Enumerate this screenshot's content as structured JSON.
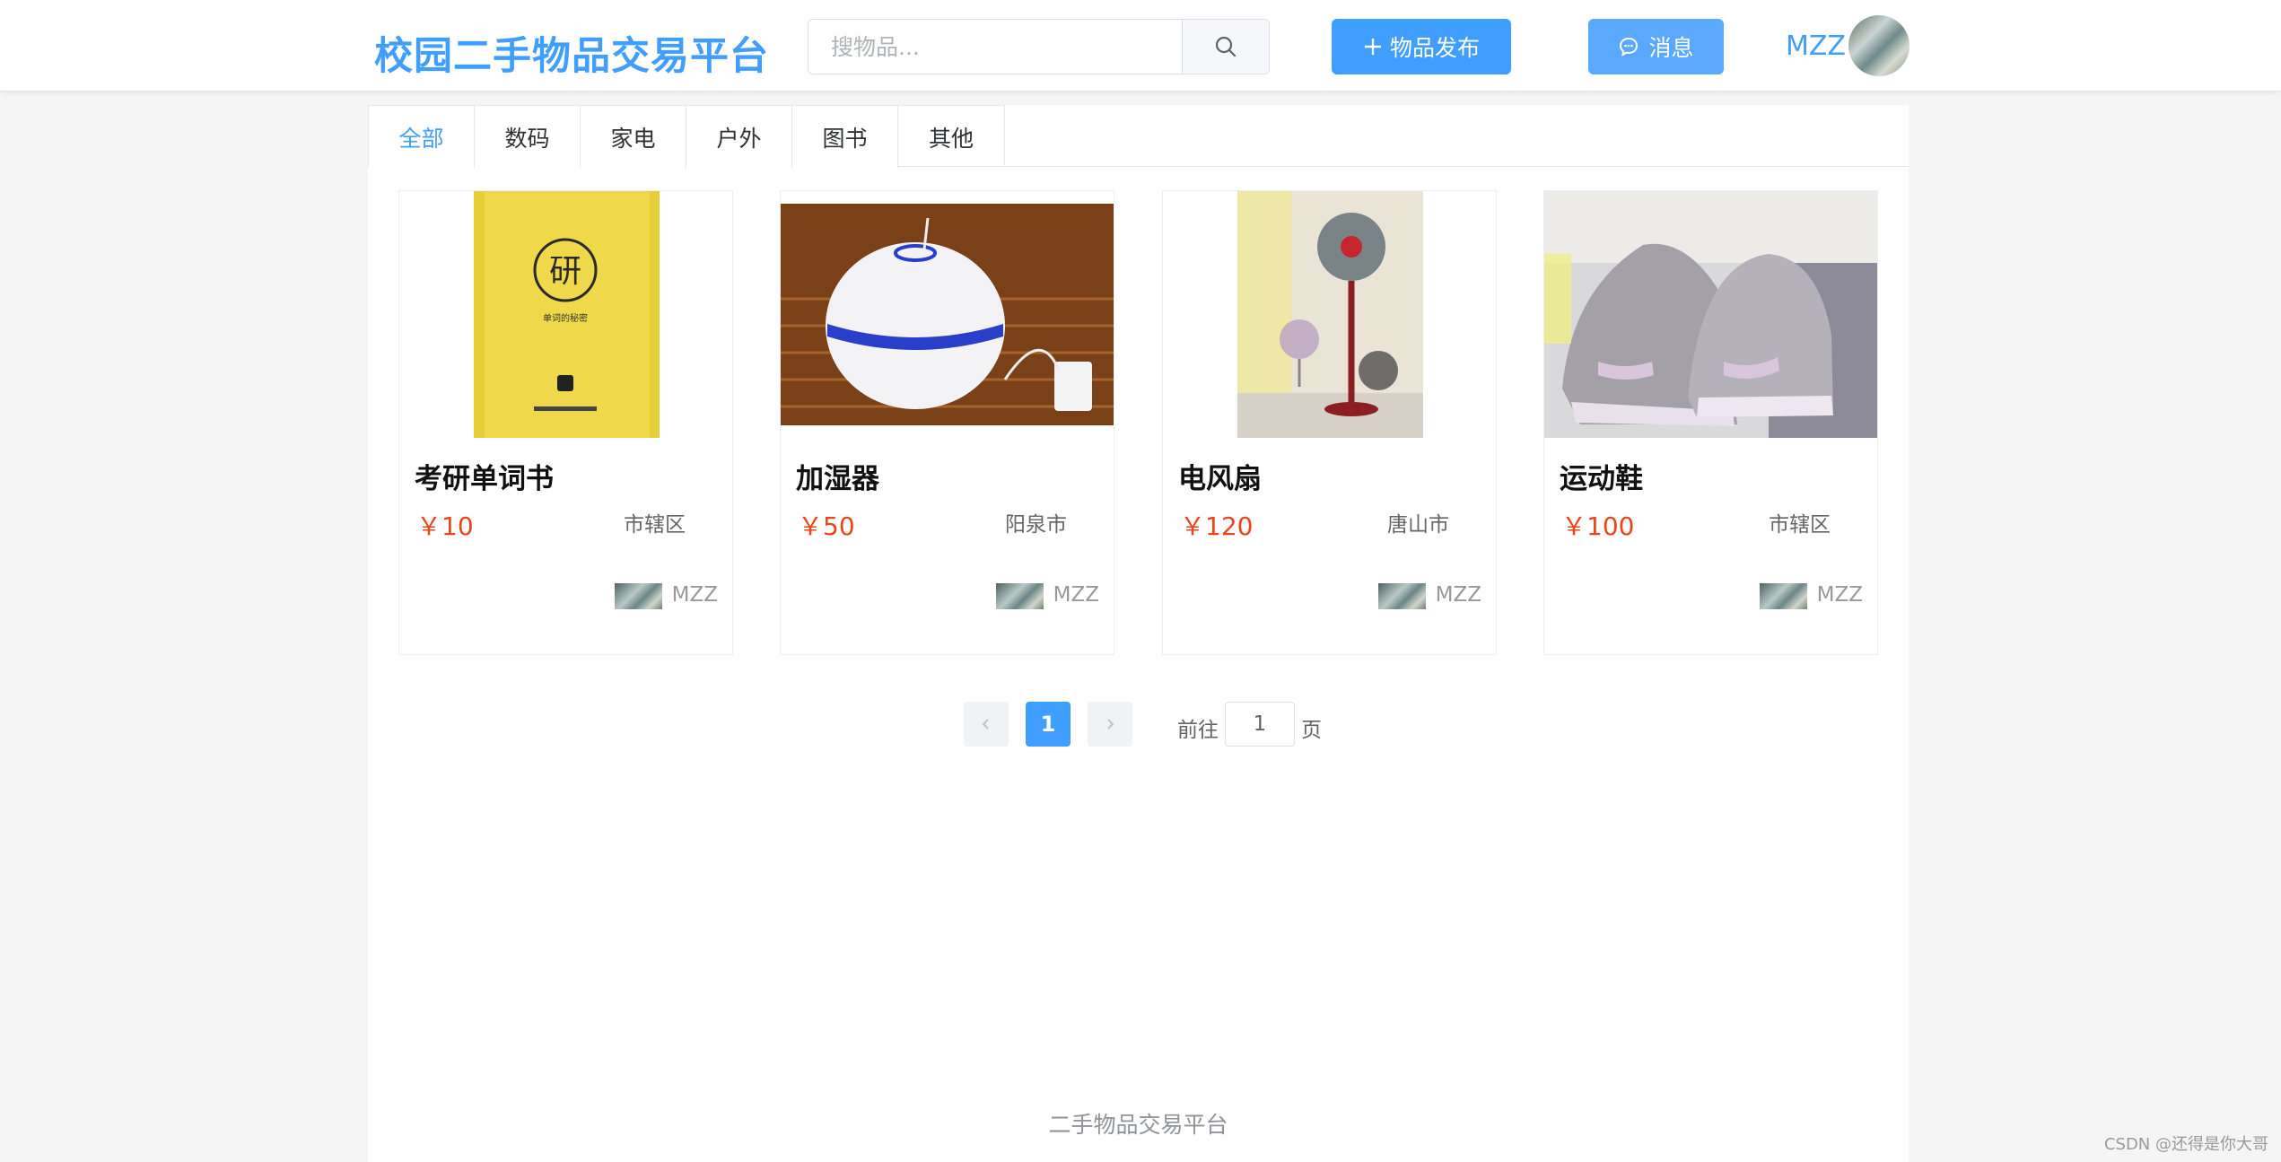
{
  "header": {
    "logo": "校园二手物品交易平台",
    "search_placeholder": "搜物品...",
    "search_icon": "search-icon",
    "publish_label": "物品发布",
    "message_label": "消息",
    "user_name": "MZZ"
  },
  "tabs": [
    {
      "label": "全部",
      "active": true
    },
    {
      "label": "数码",
      "active": false
    },
    {
      "label": "家电",
      "active": false
    },
    {
      "label": "户外",
      "active": false
    },
    {
      "label": "图书",
      "active": false
    },
    {
      "label": "其他",
      "active": false
    }
  ],
  "items": [
    {
      "title": "考研单词书",
      "price": "￥10",
      "location": "市辖区",
      "seller": "MZZ",
      "image": "vocabulary-book-photo"
    },
    {
      "title": "加湿器",
      "price": "￥50",
      "location": "阳泉市",
      "seller": "MZZ",
      "image": "humidifier-photo"
    },
    {
      "title": "电风扇",
      "price": "￥120",
      "location": "唐山市",
      "seller": "MZZ",
      "image": "electric-fan-photo"
    },
    {
      "title": "运动鞋",
      "price": "￥100",
      "location": "市辖区",
      "seller": "MZZ",
      "image": "sneakers-photo"
    }
  ],
  "pagination": {
    "current_page": "1",
    "goto_prefix": "前往",
    "goto_value": "1",
    "goto_suffix": "页"
  },
  "book_cover_text": {
    "char": "研",
    "subtitle": "单词的秘密"
  },
  "footer": "二手物品交易平台",
  "watermark": "CSDN @还得是你大哥",
  "colors": {
    "accent": "#409eff",
    "price": "#e8461b"
  }
}
